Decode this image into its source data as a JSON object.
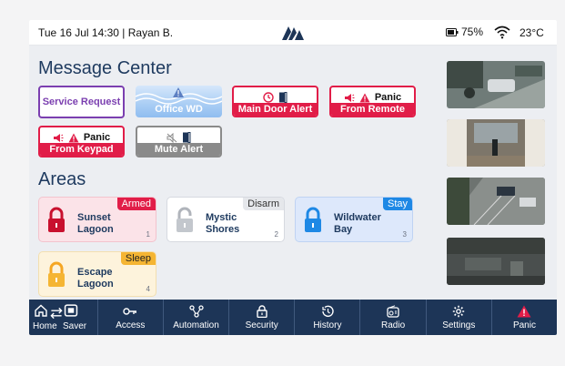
{
  "status_bar": {
    "datetime_user": "Tue 16 Jul 14:30 | Rayan B.",
    "battery": "75%",
    "temperature": "23°C"
  },
  "message_center": {
    "title": "Message Center",
    "tiles": [
      {
        "label": "Service Request"
      },
      {
        "label": "Office WD"
      },
      {
        "label": "Main Door Alert"
      },
      {
        "top": "Panic",
        "label": "From Remote"
      },
      {
        "top": "Panic",
        "label": "From Keypad"
      },
      {
        "label": "Mute Alert"
      }
    ]
  },
  "areas": {
    "title": "Areas",
    "items": [
      {
        "name_line1": "Sunset",
        "name_line2": "Lagoon",
        "status": "Armed",
        "number": "1"
      },
      {
        "name_line1": "Mystic",
        "name_line2": "Shores",
        "status": "Disarm",
        "number": "2"
      },
      {
        "name_line1": "Wildwater",
        "name_line2": "Bay",
        "status": "Stay",
        "number": "3"
      },
      {
        "name_line1": "Escape",
        "name_line2": "Lagoon",
        "status": "Sleep",
        "number": "4"
      }
    ]
  },
  "nav": {
    "home": "Home",
    "saver": "Saver",
    "access": "Access",
    "automation": "Automation",
    "security": "Security",
    "history": "History",
    "radio": "Radio",
    "settings": "Settings",
    "panic": "Panic"
  },
  "colors": {
    "navy": "#1d3557",
    "armed": "#e11d48",
    "stay": "#1e88e5",
    "sleep": "#f5b533",
    "purple": "#7b3fb0"
  }
}
